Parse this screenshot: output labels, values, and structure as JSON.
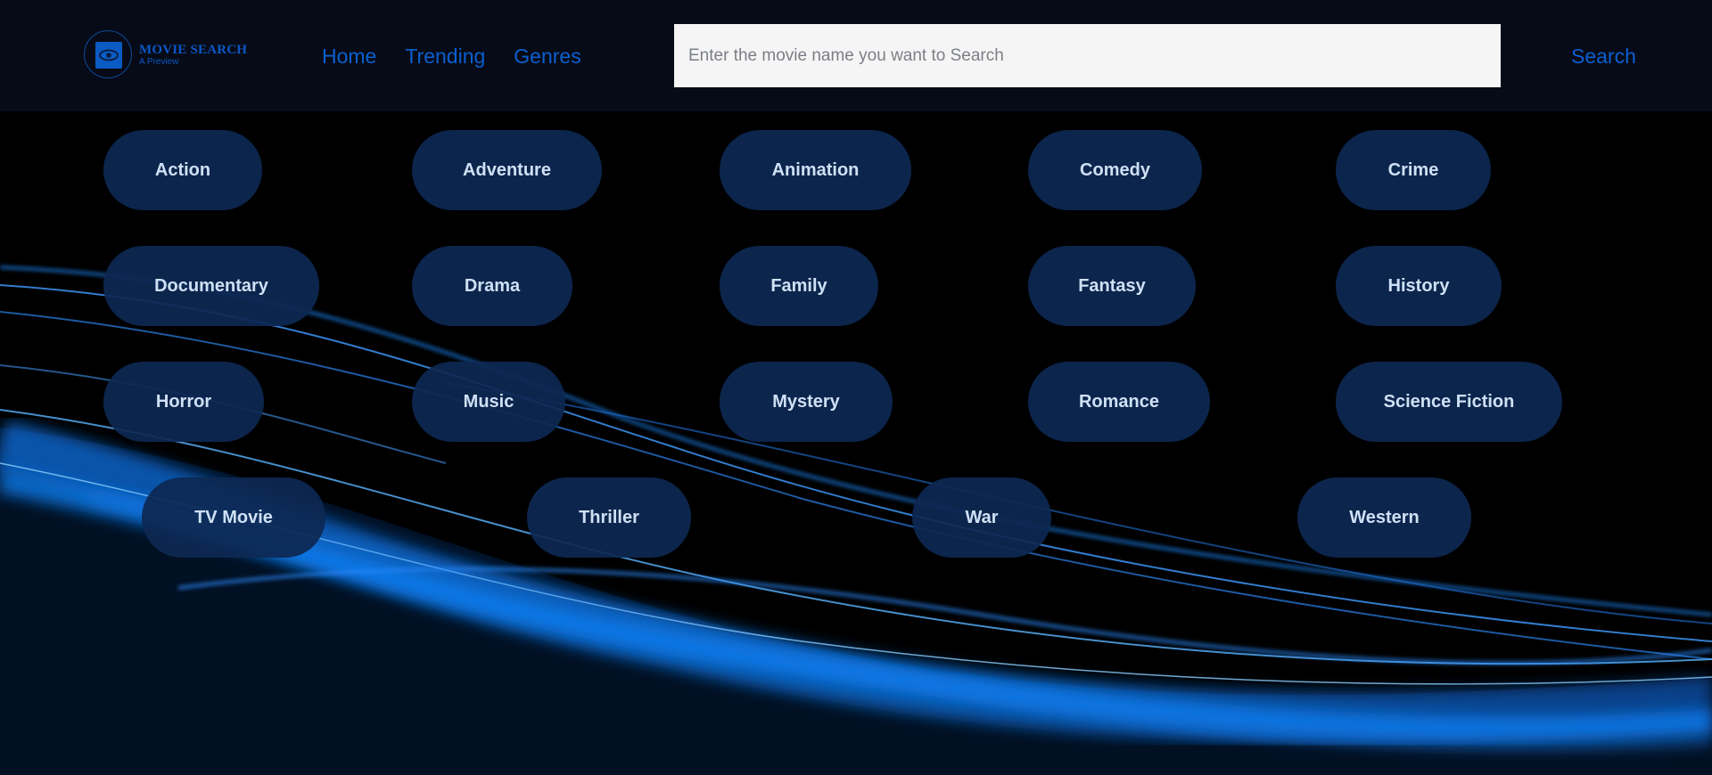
{
  "logo": {
    "title": "MOVIE SEARCH",
    "subtitle": "A Preview",
    "icon": "eye-icon"
  },
  "nav": {
    "items": [
      {
        "label": "Home"
      },
      {
        "label": "Trending"
      },
      {
        "label": "Genres"
      }
    ]
  },
  "search": {
    "placeholder": "Enter the movie name you want to Search",
    "value": "",
    "button_label": "Search"
  },
  "genres": [
    "Action",
    "Adventure",
    "Animation",
    "Comedy",
    "Crime",
    "Documentary",
    "Drama",
    "Family",
    "Fantasy",
    "History",
    "Horror",
    "Music",
    "Mystery",
    "Romance",
    "Science Fiction",
    "TV Movie",
    "Thriller",
    "War",
    "Western"
  ],
  "colors": {
    "navbar_bg": "#070b17",
    "accent": "#0b5fd0",
    "pill_bg": "#0d2852",
    "pill_text": "#cfe0f5"
  }
}
